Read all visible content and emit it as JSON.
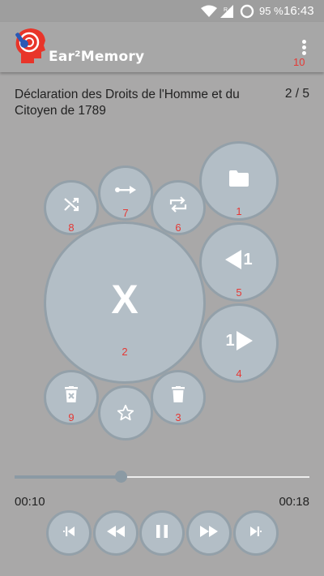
{
  "status_bar": {
    "battery": "95 %",
    "time": "16:43"
  },
  "app_bar": {
    "title": "Ear²Memory",
    "overflow_number": "10"
  },
  "track": {
    "title": "Déclaration des Droits de l'Homme et du Citoyen de 1789",
    "position": "2 / 5"
  },
  "buttons": {
    "open_folder": {
      "number": "1",
      "icon": "folder-icon"
    },
    "clear": {
      "label": "X",
      "number": "2"
    },
    "delete": {
      "number": "3",
      "icon": "trash-icon"
    },
    "next_item": {
      "number": "4",
      "icon": "next-item-icon",
      "label": "1"
    },
    "prev_item": {
      "number": "5",
      "icon": "previous-item-icon",
      "label": "1"
    },
    "repeat": {
      "number": "6",
      "icon": "repeat-icon"
    },
    "sequential": {
      "number": "7",
      "icon": "sequential-icon"
    },
    "shuffle": {
      "number": "8",
      "icon": "shuffle-icon"
    },
    "delete_marked": {
      "number": "9",
      "icon": "trash-x-icon"
    },
    "favorite": {
      "icon": "star-icon"
    }
  },
  "player": {
    "elapsed": "00:10",
    "duration": "00:18",
    "progress": 0.36
  },
  "colors": {
    "accent": "#e53935",
    "button_fill": "#b3bec6",
    "button_border": "#93a0a9",
    "background": "#a9a8a8"
  }
}
